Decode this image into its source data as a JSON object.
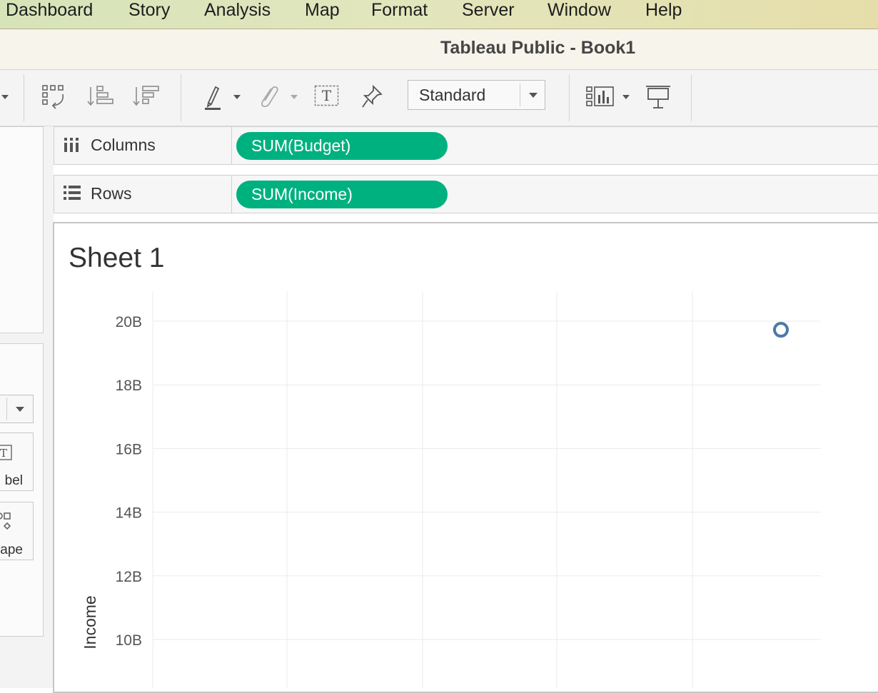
{
  "menubar": {
    "items": [
      "Dashboard",
      "Story",
      "Analysis",
      "Map",
      "Format",
      "Server",
      "Window",
      "Help"
    ]
  },
  "window": {
    "title": "Tableau Public - Book1"
  },
  "toolbar": {
    "fit_select_value": "Standard",
    "icons": [
      "swap-rows-columns-icon",
      "sort-ascending-icon",
      "sort-descending-icon",
      "highlight-icon",
      "group-members-icon",
      "show-mark-labels-icon",
      "fix-axes-icon",
      "show-me-icon",
      "presentation-mode-icon"
    ]
  },
  "left_pane": {
    "cards": [
      {
        "label": "bel",
        "icon": "label-icon"
      },
      {
        "label": "ape",
        "icon": "shape-icon"
      }
    ]
  },
  "shelves": {
    "columns": {
      "label": "Columns",
      "pill": "SUM(Budget)"
    },
    "rows": {
      "label": "Rows",
      "pill": "SUM(Income)"
    }
  },
  "sheet": {
    "title": "Sheet 1"
  },
  "colors": {
    "pill": "#00b180",
    "mark": "#4e79a7",
    "gridline": "#ebebeb"
  },
  "chart_data": {
    "type": "scatter",
    "title": "Sheet 1",
    "xlabel": "",
    "ylabel": "Income",
    "y_tick_labels": [
      "20B",
      "18B",
      "16B",
      "14B",
      "12B",
      "10B"
    ],
    "y_ticks": [
      20,
      18,
      16,
      14,
      12,
      10
    ],
    "y_unit": "B",
    "ylim": [
      9.4,
      20.9
    ],
    "x_gridlines": 5,
    "grid": true,
    "mark_shape": "open-circle",
    "series": [
      {
        "points": [
          {
            "y": 19.73
          }
        ]
      }
    ]
  }
}
